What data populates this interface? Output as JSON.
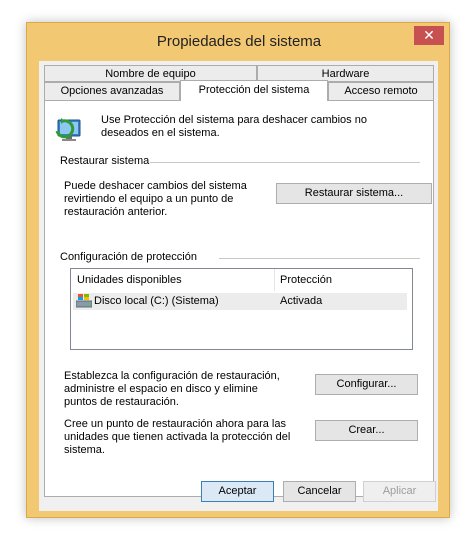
{
  "window": {
    "title": "Propiedades del sistema",
    "close_glyph": "✕"
  },
  "tabs": {
    "row1": [
      "Nombre de equipo",
      "Hardware"
    ],
    "row2": [
      "Opciones avanzadas",
      "Protección del sistema",
      "Acceso remoto"
    ],
    "active": "Protección del sistema"
  },
  "intro": {
    "icon": "system-protection-icon",
    "text": "Use Protección del sistema para deshacer cambios no deseados en el sistema."
  },
  "restore": {
    "heading": "Restaurar sistema",
    "description": "Puede deshacer cambios del sistema revirtiendo el equipo a un punto de restauración anterior.",
    "button": "Restaurar sistema..."
  },
  "protection": {
    "heading": "Configuración de protección",
    "columns": [
      "Unidades disponibles",
      "Protección"
    ],
    "rows": [
      {
        "icon": "local-disk-icon",
        "drive": "Disco local (C:) (Sistema)",
        "status": "Activada"
      }
    ],
    "configure_text": "Establezca la configuración de restauración, administre el espacio en disco y elimine puntos de restauración.",
    "configure_button": "Configurar...",
    "create_text": "Cree un punto de restauración ahora para las unidades que tienen activada la protección del sistema.",
    "create_button": "Crear..."
  },
  "footer": {
    "ok": "Aceptar",
    "cancel": "Cancelar",
    "apply": "Aplicar"
  },
  "colors": {
    "frame": "#f3c873",
    "close": "#c75050",
    "default_button_border": "#3c7fb1"
  }
}
